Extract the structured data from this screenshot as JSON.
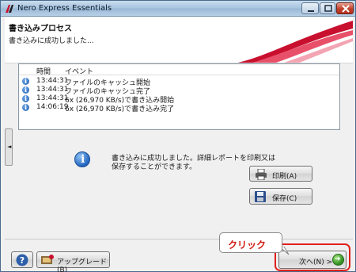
{
  "window": {
    "title": "Nero Express Essentials"
  },
  "header": {
    "title": "書き込みプロセス",
    "subtitle": "書き込みに成功しました..."
  },
  "log": {
    "columns": {
      "time": "時間",
      "event": "イベント"
    },
    "rows": [
      {
        "time": "13:44:31",
        "event": "ファイルのキャッシュ開始",
        "icon": "info-icon"
      },
      {
        "time": "13:44:31",
        "event": "ファイルのキャッシュ完了",
        "icon": "info-icon"
      },
      {
        "time": "13:44:31",
        "event": "6x (26,970 KB/s)で書き込み開始",
        "icon": "info-icon"
      },
      {
        "time": "14:06:19",
        "event": "6x (26,970 KB/s)で書き込み完了",
        "icon": "info-icon"
      }
    ]
  },
  "side_tab": {
    "icon": "triangle-left-icon",
    "label": "◄"
  },
  "message": {
    "line1": "書き込みに成功しました。詳細レポートを印刷又は",
    "line2": "保存することができます。"
  },
  "buttons": {
    "print": "印刷(A)",
    "save": "保存(C)",
    "upgrade": "アップグレード(B)",
    "next": "次へ(N) >"
  },
  "annotation": {
    "callout": "クリック",
    "highlight_color": "#e0201a"
  },
  "colors": {
    "title_bar": "#b7cfe6",
    "accent_wave": "#c8102e"
  }
}
